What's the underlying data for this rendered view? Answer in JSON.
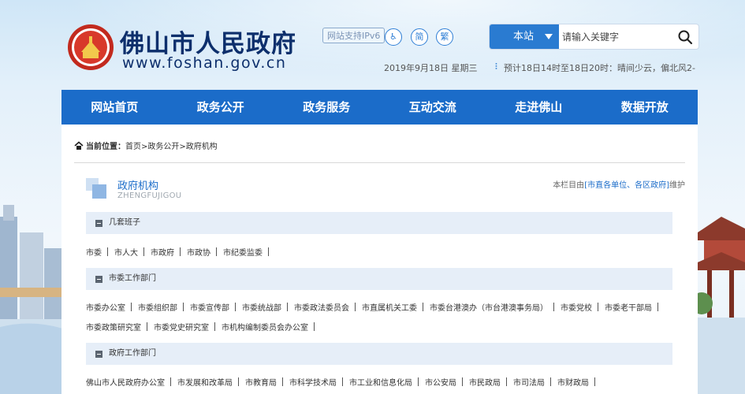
{
  "header": {
    "title": "佛山市人民政府",
    "domain": "www.foshan.gov.cn",
    "ipv6_badge": "网站支持IPv6",
    "simplified_label": "简",
    "traditional_label": "繁",
    "accessibility_label": "♿",
    "date": "2019年9月18日 星期三",
    "weather": "预计18日14时至18日20时：晴间少云，偏北风2-"
  },
  "search": {
    "scope": "本站",
    "placeholder": "请输入关键字"
  },
  "nav": {
    "items": [
      "网站首页",
      "政务公开",
      "政务服务",
      "互动交流",
      "走进佛山",
      "数据开放"
    ]
  },
  "breadcrumb": {
    "label": "当前位置：",
    "path": "首页>政务公开>政府机构"
  },
  "section": {
    "title": "政府机构",
    "subtitle": "ZHENGFUJIGOU",
    "note_prefix": "本栏目由",
    "note_link": "[市直各单位、各区政府]",
    "note_suffix": "维护"
  },
  "groups": [
    {
      "title": "几套班子",
      "rows": [
        [
          "市委",
          "市人大",
          "市政府",
          "市政协",
          "市纪委监委"
        ]
      ]
    },
    {
      "title": "市委工作部门",
      "rows": [
        [
          "市委办公室",
          "市委组织部",
          "市委宣传部",
          "市委统战部",
          "市委政法委员会",
          "市直属机关工委",
          "市委台港澳办（市台港澳事务局）",
          "市委党校",
          "市委老干部局"
        ],
        [
          "市委政策研究室",
          "市委党史研究室",
          "市机构编制委员会办公室"
        ]
      ]
    },
    {
      "title": "政府工作部门",
      "rows": [
        [
          "佛山市人民政府办公室",
          "市发展和改革局",
          "市教育局",
          "市科学技术局",
          "市工业和信息化局",
          "市公安局",
          "市民政局",
          "市司法局",
          "市财政局"
        ]
      ]
    }
  ],
  "colors": {
    "brand_blue": "#1b6cc9",
    "title_navy": "#0d2f6c",
    "group_header_bg": "#e6eef8"
  }
}
